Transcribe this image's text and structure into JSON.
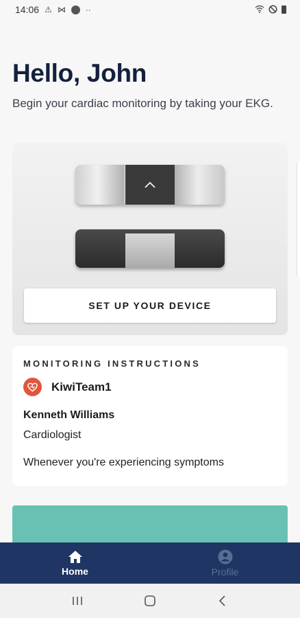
{
  "status_bar": {
    "time": "14:06",
    "left_icons": [
      "warning-icon",
      "gmail-icon",
      "circle-icon",
      "more-dots-icon"
    ],
    "right_icons": [
      "wifi-off-icon",
      "do-not-disturb-icon",
      "battery-icon"
    ]
  },
  "greeting": {
    "title": "Hello, John",
    "subtitle": "Begin your cardiac monitoring by taking your EKG."
  },
  "device_card": {
    "setup_button_label": "SET UP YOUR DEVICE"
  },
  "instructions": {
    "heading": "MONITORING INSTRUCTIONS",
    "team_name": "KiwiTeam1",
    "team_icon": "heart-icon",
    "team_icon_color": "#e0563b",
    "doctor_name": "Kenneth Williams",
    "doctor_role": "Cardiologist",
    "note": "Whenever you're experiencing symptoms"
  },
  "bottom_nav": {
    "items": [
      {
        "label": "Home",
        "icon": "home-icon",
        "active": true
      },
      {
        "label": "Profile",
        "icon": "profile-icon",
        "active": false
      }
    ]
  },
  "colors": {
    "nav_background": "#1f3563",
    "teal_card": "#69c1b3",
    "heading_text": "#14213d"
  }
}
